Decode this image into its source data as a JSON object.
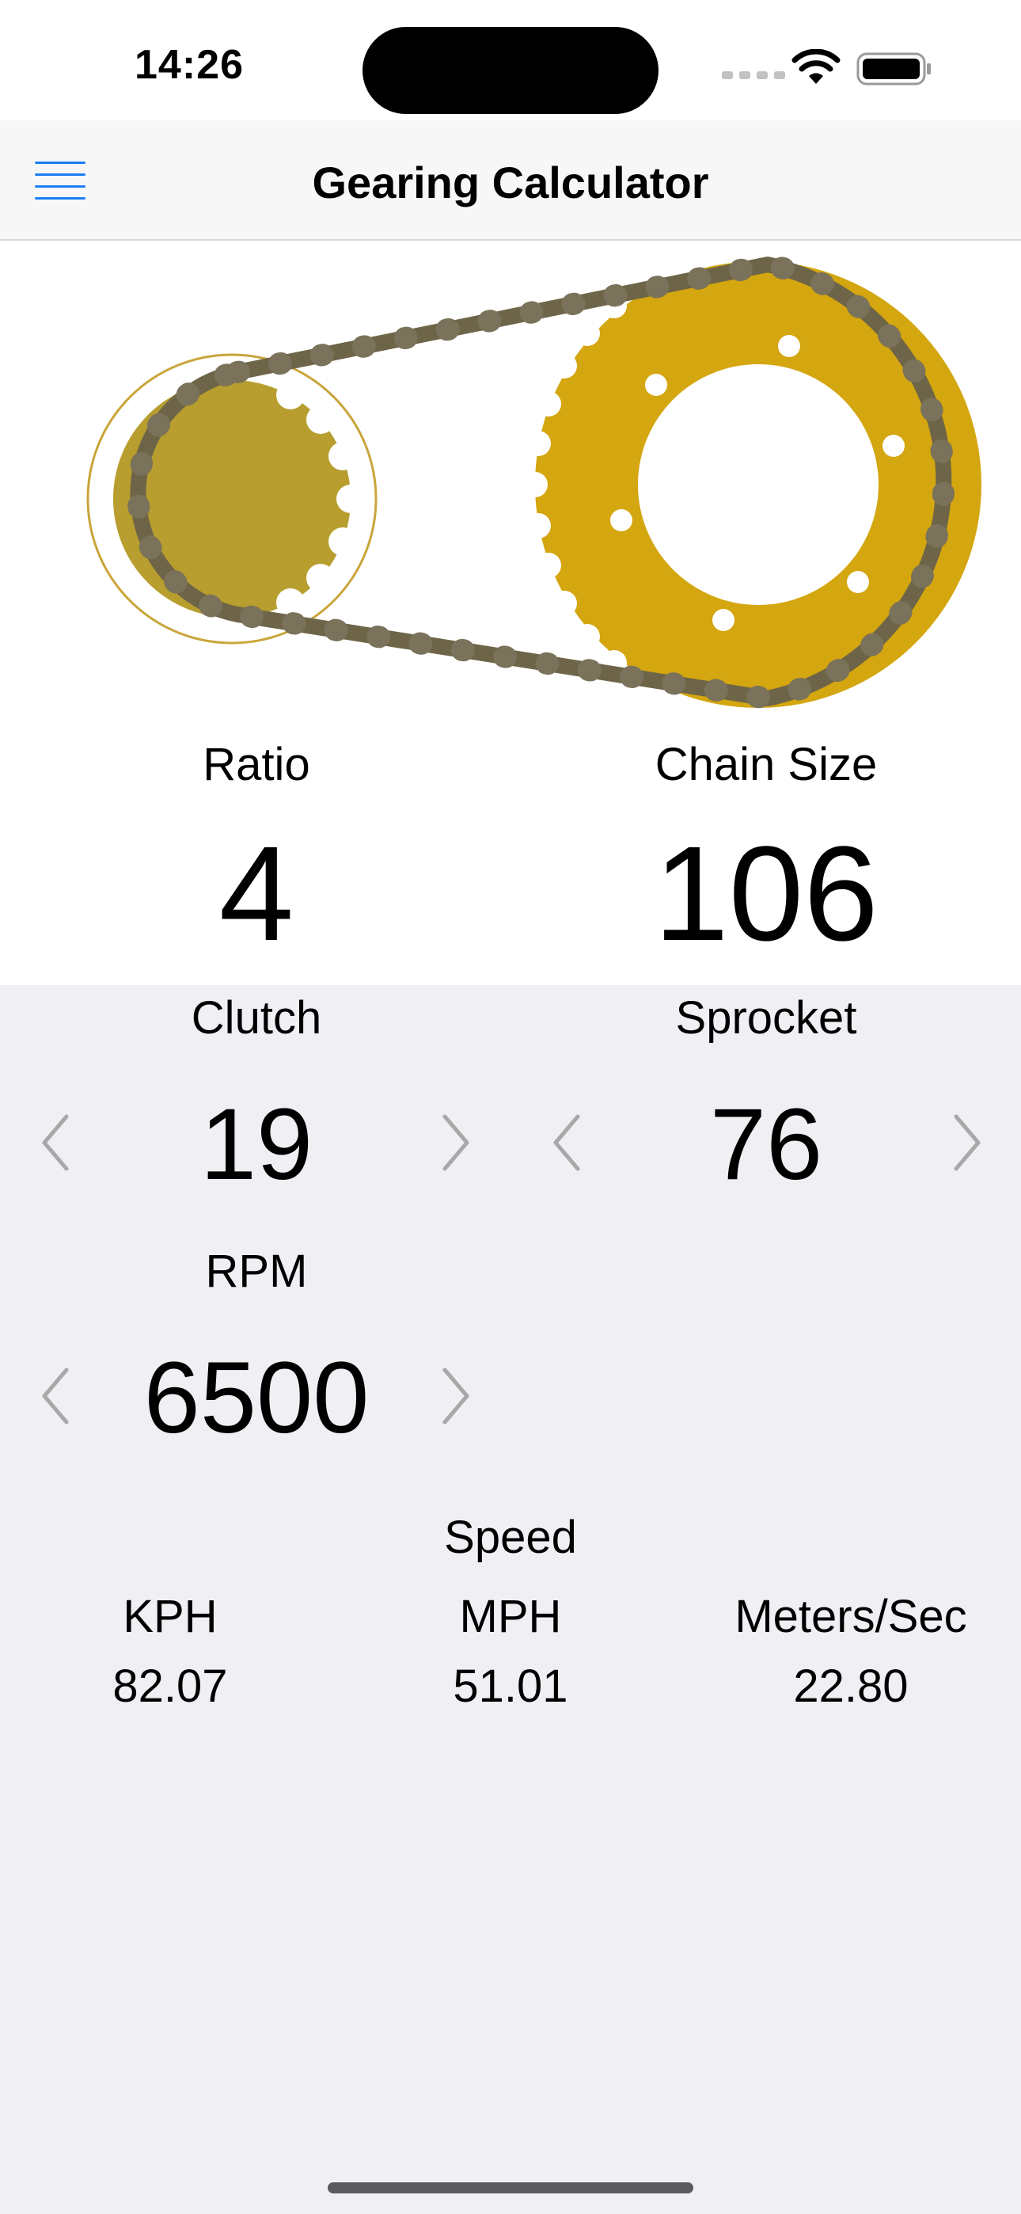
{
  "status_bar": {
    "time": "14:26",
    "icons": [
      "cellular-signal-icon",
      "wifi-icon",
      "battery-icon"
    ]
  },
  "nav": {
    "title": "Gearing Calculator",
    "menu_icon": "hamburger-menu-icon"
  },
  "illustration": {
    "icon": "chain-drive-illustration",
    "colors": {
      "small_sprocket": "#b79e2e",
      "large_sprocket": "#d4a60f",
      "chain": "#6e6548"
    }
  },
  "results": {
    "ratio_label": "Ratio",
    "ratio_value": "4",
    "chain_label": "Chain Size",
    "chain_value": "106"
  },
  "controls": {
    "clutch_label": "Clutch",
    "clutch_value": "19",
    "sprocket_label": "Sprocket",
    "sprocket_value": "76",
    "rpm_label": "RPM",
    "rpm_value": "6500",
    "decrement_icon": "chevron-left-icon",
    "increment_icon": "chevron-right-icon"
  },
  "speed": {
    "title": "Speed",
    "kph_label": "KPH",
    "kph_value": "82.07",
    "mph_label": "MPH",
    "mph_value": "51.01",
    "ms_label": "Meters/Sec",
    "ms_value": "22.80"
  },
  "theme": {
    "accent": "#1a7ef5",
    "background": "#efeff4",
    "panel": "#ffffff",
    "arrow_color": "#a8a8a8"
  }
}
